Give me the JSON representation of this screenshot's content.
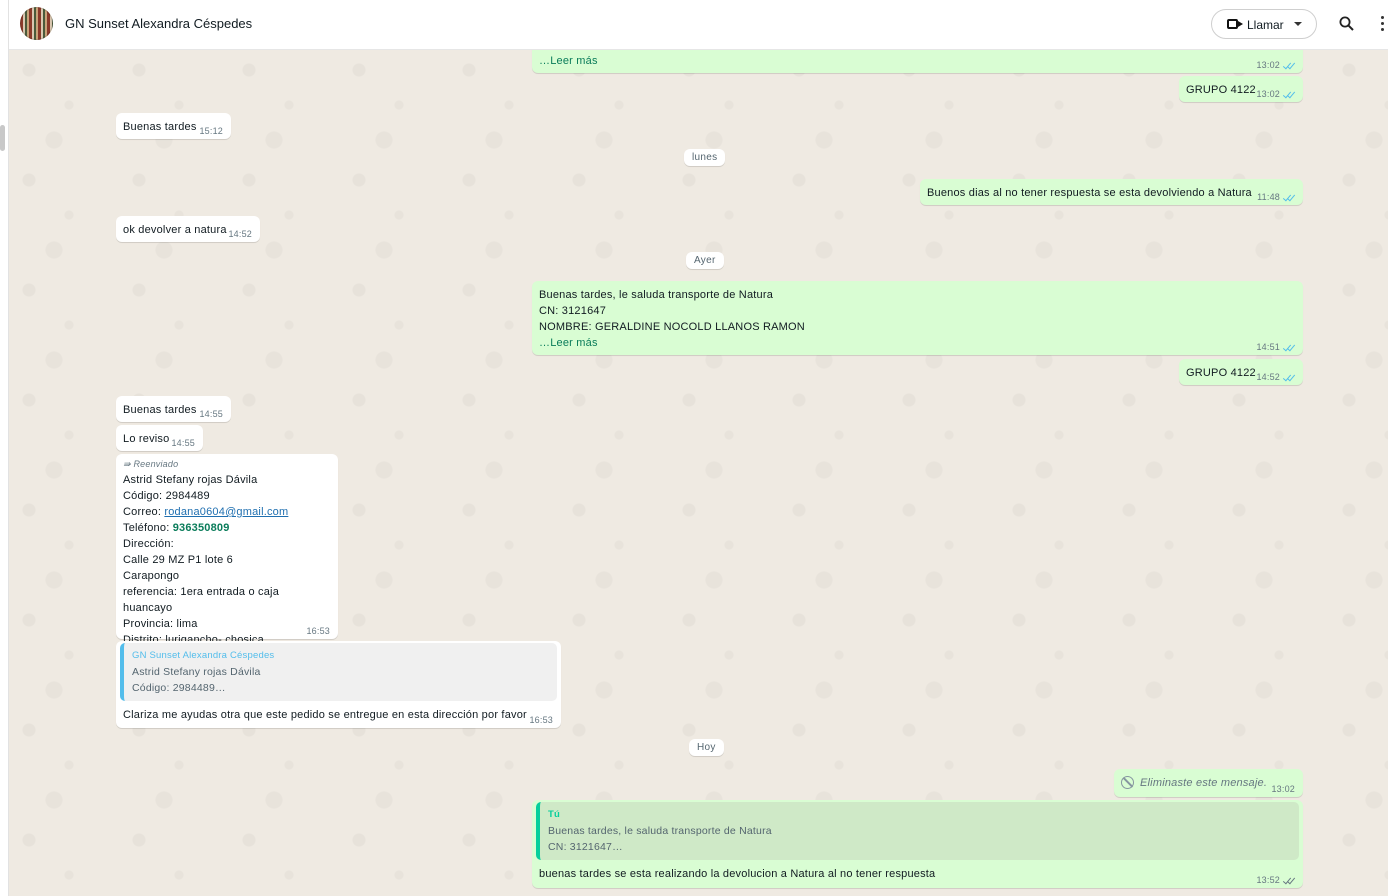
{
  "header": {
    "title": "GN Sunset Alexandra Céspedes",
    "call_label": "Llamar"
  },
  "day_labels": {
    "monday": "lunes",
    "yesterday": "Ayer",
    "today": "Hoy"
  },
  "messages": {
    "m1": {
      "text": "…Leer más",
      "time": "13:02"
    },
    "m2": {
      "text": "GRUPO 4122",
      "time": "13:02"
    },
    "m3": {
      "text": "Buenas tardes",
      "time": "15:12"
    },
    "m4": {
      "text": "Buenos dias al no tener respuesta se esta devolviendo a Natura",
      "time": "11:48"
    },
    "m5": {
      "text": "ok devolver a natura",
      "time": "14:52"
    },
    "m6": {
      "line1": "Buenas tardes, le saluda transporte de Natura",
      "line2": "CN:  3121647",
      "line3": "NOMBRE:  GERALDINE NOCOLD  LLANOS RAMON",
      "readmore": "…Leer más",
      "time": "14:51"
    },
    "m7": {
      "text": "GRUPO 4122",
      "time": "14:52"
    },
    "m8": {
      "text": "Buenas tardes",
      "time": "14:55"
    },
    "m9": {
      "text": "Lo reviso",
      "time": "14:55"
    },
    "m10": {
      "forwarded": "Reenviado",
      "name": "Astrid Stefany rojas Dávila",
      "code": "Código: 2984489",
      "email_label": "Correo: ",
      "email": "rodana0604@gmail.com",
      "phone_label": "Teléfono: ",
      "phone": "936350809",
      "address_label": "Dirección:",
      "address1": "Calle 29 MZ P1 lote 6",
      "address2": "Carapongo",
      "reference": "referencia: 1era entrada o caja huancayo",
      "province": "Provincia: lima",
      "district": "Distrito: lurigancho- chosica",
      "time": "16:53"
    },
    "m11": {
      "quote_name": "GN Sunset Alexandra Céspedes",
      "quote_line1": "Astrid Stefany rojas Dávila",
      "quote_line2": "Código: 2984489…",
      "text": "Clariza me ayudas otra que este pedido se entregue en esta dirección por favor",
      "time": "16:53"
    },
    "m12": {
      "text": "Eliminaste este mensaje.",
      "time": "13:02"
    },
    "m13": {
      "quote_name": "Tú",
      "quote_line1": "Buenas tardes, le saluda transporte de Natura",
      "quote_line2": "CN:  3121647…",
      "text": "buenas tardes se esta realizando la devolucion a Natura al no tener respuesta",
      "time": "13:52"
    }
  }
}
